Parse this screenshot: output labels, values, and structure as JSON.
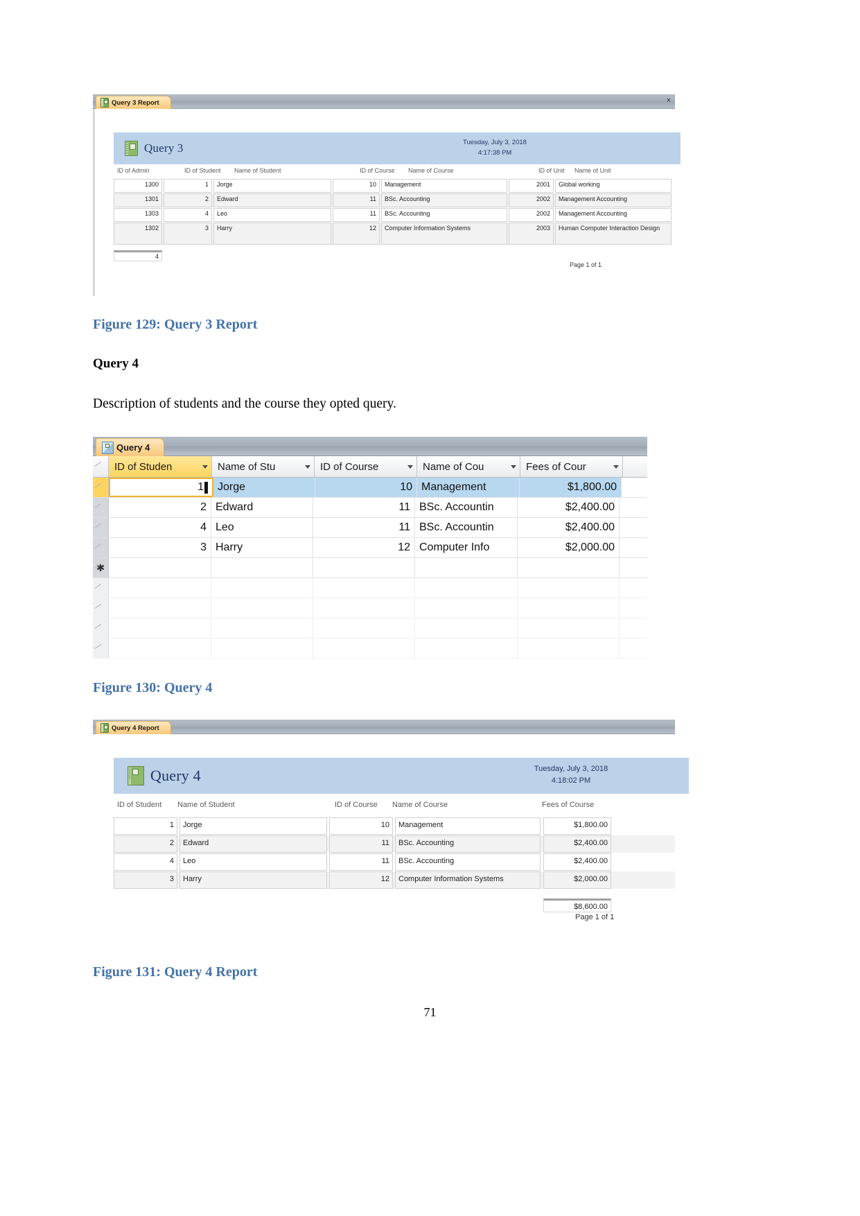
{
  "page": {
    "number": "71"
  },
  "report3": {
    "tab_label": "Query 3 Report",
    "tab_icon": "report-icon",
    "close_icon": "close-icon",
    "title": "Query 3",
    "title_icon": "report-book-icon",
    "date": "Tuesday, July 3, 2018",
    "time": "4:17:38 PM",
    "columns": [
      "ID of Admin",
      "ID of Student",
      "Name of Student",
      "ID of Course",
      "Name of Course",
      "ID of Unit",
      "Name of Unit"
    ],
    "rows": [
      {
        "id_admin": "1300",
        "id_student": "1",
        "name_student": "Jorge",
        "id_course": "10",
        "name_course": "Management",
        "id_unit": "2001",
        "name_unit": "Global working"
      },
      {
        "id_admin": "1301",
        "id_student": "2",
        "name_student": "Edward",
        "id_course": "11",
        "name_course": "BSc. Accounting",
        "id_unit": "2002",
        "name_unit": "Management Accounting"
      },
      {
        "id_admin": "1303",
        "id_student": "4",
        "name_student": "Leo",
        "id_course": "11",
        "name_course": "BSc. Accounting",
        "id_unit": "2002",
        "name_unit": "Management Accounting"
      },
      {
        "id_admin": "1302",
        "id_student": "3",
        "name_student": "Harry",
        "id_course": "12",
        "name_course": "Computer Information Systems",
        "id_unit": "2003",
        "name_unit": "Human Computer Interaction Design"
      }
    ],
    "total": "4",
    "page_footer": "Page 1 of 1"
  },
  "caption129": "Figure 129: Query 3 Report",
  "heading_query4": "Query 4",
  "paragraph_query4": "Description of students and the course they opted query.",
  "datasheet4": {
    "tab_label": "Query 4",
    "tab_icon": "query-icon",
    "columns": [
      {
        "label": "ID of Studen",
        "dropdown_icon": "chevron-down-icon"
      },
      {
        "label": "Name of Stu",
        "dropdown_icon": "chevron-down-icon"
      },
      {
        "label": "ID of Course",
        "dropdown_icon": "chevron-down-icon"
      },
      {
        "label": "Name of Cou",
        "dropdown_icon": "chevron-down-icon"
      },
      {
        "label": "Fees of Cour",
        "dropdown_icon": "chevron-down-icon"
      }
    ],
    "rows": [
      {
        "id_student": "1",
        "name_student": "Jorge",
        "id_course": "10",
        "name_course": "Management",
        "fees": "$1,800.00",
        "selected": true
      },
      {
        "id_student": "2",
        "name_student": "Edward",
        "id_course": "11",
        "name_course": "BSc. Accountin",
        "fees": "$2,400.00",
        "selected": false
      },
      {
        "id_student": "4",
        "name_student": "Leo",
        "id_course": "11",
        "name_course": "BSc. Accountin",
        "fees": "$2,400.00",
        "selected": false
      },
      {
        "id_student": "3",
        "name_student": "Harry",
        "id_course": "12",
        "name_course": "Computer Info",
        "fees": "$2,000.00",
        "selected": false
      }
    ],
    "new_record_marker": "✱",
    "accent_color": "#fdd45f",
    "selection_color": "#b8d8f0"
  },
  "caption130": "Figure 130: Query 4",
  "report4": {
    "tab_label": "Query 4 Report",
    "tab_icon": "report-icon",
    "title": "Query 4",
    "title_icon": "report-book-icon",
    "date": "Tuesday, July 3, 2018",
    "time": "4:18:02 PM",
    "columns": [
      "ID of Student",
      "Name of Student",
      "ID of Course",
      "Name of Course",
      "Fees of Course"
    ],
    "rows": [
      {
        "id_student": "1",
        "name_student": "Jorge",
        "id_course": "10",
        "name_course": "Management",
        "fees": "$1,800.00"
      },
      {
        "id_student": "2",
        "name_student": "Edward",
        "id_course": "11",
        "name_course": "BSc. Accounting",
        "fees": "$2,400.00"
      },
      {
        "id_student": "4",
        "name_student": "Leo",
        "id_course": "11",
        "name_course": "BSc. Accounting",
        "fees": "$2,400.00"
      },
      {
        "id_student": "3",
        "name_student": "Harry",
        "id_course": "12",
        "name_course": "Computer Information Systems",
        "fees": "$2,000.00"
      }
    ],
    "total": "$8,600.00",
    "page_footer": "Page 1 of 1"
  },
  "caption131": "Figure 131: Query 4 Report"
}
